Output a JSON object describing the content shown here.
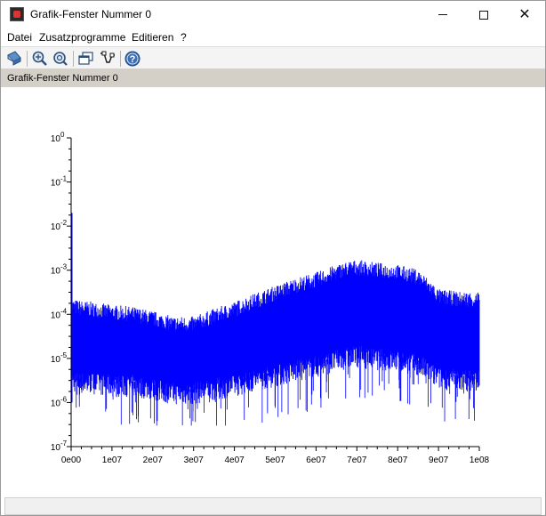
{
  "window": {
    "title": "Grafik-Fenster Nummer 0",
    "controls": {
      "minimize": "",
      "maximize": "",
      "close": "✕"
    }
  },
  "menu": {
    "items": [
      "Datei",
      "Zusatzprogramme",
      "Editieren",
      "?"
    ]
  },
  "toolbar": {
    "icons": [
      "rotate-icon",
      "zoom-in-icon",
      "zoom-out-icon",
      "windows-icon",
      "datatip-icon",
      "help-icon"
    ]
  },
  "infobar": {
    "text": "Grafik-Fenster Nummer 0"
  },
  "colors": {
    "series": "#0000ff",
    "axis": "#000000",
    "infobar": "#d4d0c8"
  },
  "chart_data": {
    "type": "line",
    "title": "",
    "xlabel": "",
    "ylabel": "",
    "yscale": "log",
    "xlim": [
      0,
      100000000
    ],
    "ylim": [
      1e-07,
      1
    ],
    "grid": false,
    "x_ticks": [
      0,
      10000000,
      20000000,
      30000000,
      40000000,
      50000000,
      60000000,
      70000000,
      80000000,
      90000000,
      100000000
    ],
    "x_tick_labels": [
      "0e00",
      "1e07",
      "2e07",
      "3e07",
      "4e07",
      "5e07",
      "6e07",
      "7e07",
      "8e07",
      "9e07",
      "1e08"
    ],
    "y_ticks": [
      {
        "value": 1,
        "base": "10",
        "exp": "0"
      },
      {
        "value": 0.1,
        "base": "10",
        "exp": "-1"
      },
      {
        "value": 0.01,
        "base": "10",
        "exp": "-2"
      },
      {
        "value": 0.001,
        "base": "10",
        "exp": "-3"
      },
      {
        "value": 0.0001,
        "base": "10",
        "exp": "-4"
      },
      {
        "value": 1e-05,
        "base": "10",
        "exp": "-5"
      },
      {
        "value": 1e-06,
        "base": "10",
        "exp": "-6"
      },
      {
        "value": 1e-07,
        "base": "10",
        "exp": "-7"
      }
    ],
    "series": [
      {
        "envelope_x": [
          0,
          2000000,
          5000000,
          10000000,
          15000000,
          20000000,
          25000000,
          30000000,
          35000000,
          40000000,
          45000000,
          50000000,
          55000000,
          60000000,
          65000000,
          68000000,
          70000000,
          72000000,
          75000000,
          80000000,
          85000000,
          88000000,
          90000000,
          95000000,
          100000000
        ],
        "upper": [
          0.00015,
          0.00014,
          0.00013,
          0.00011,
          0.0001,
          8e-05,
          6e-05,
          6e-05,
          9e-05,
          0.00013,
          0.0002,
          0.0003,
          0.00045,
          0.0006,
          0.0009,
          0.0011,
          0.00115,
          0.0011,
          0.001,
          0.0009,
          0.0007,
          0.0004,
          0.00025,
          0.00022,
          0.00022
        ],
        "lower": [
          4e-06,
          3.5e-06,
          3.5e-06,
          3e-06,
          3e-06,
          2.5e-06,
          2e-06,
          2e-06,
          2.5e-06,
          3e-06,
          4e-06,
          5e-06,
          6.5e-06,
          8e-06,
          1.1e-05,
          1.3e-05,
          1.4e-05,
          1.3e-05,
          1.2e-05,
          1.1e-05,
          9e-06,
          6e-06,
          4.5e-06,
          4e-06,
          4e-06
        ],
        "spikes_min": 3e-07
      }
    ]
  }
}
